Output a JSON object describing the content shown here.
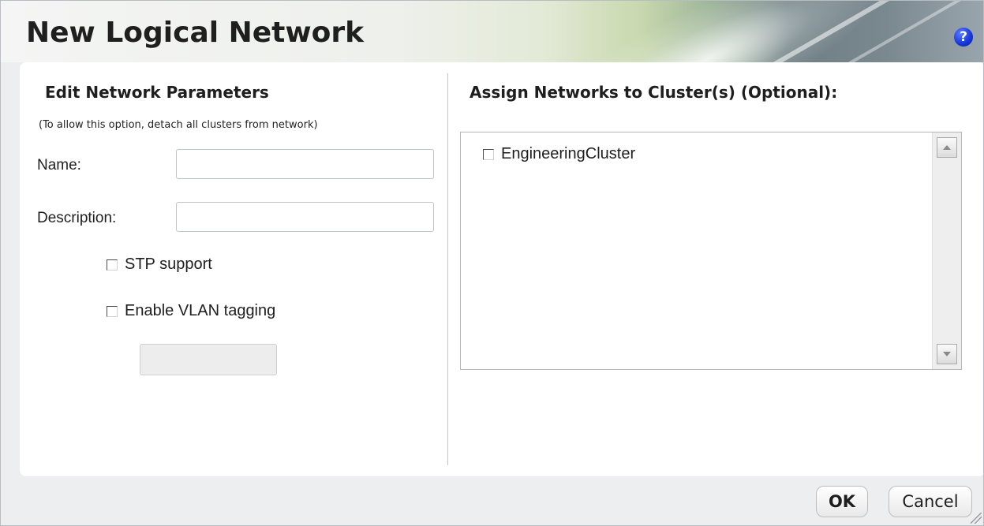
{
  "dialog": {
    "title": "New Logical Network",
    "help_icon": "question-icon",
    "help_glyph": "?"
  },
  "left": {
    "section_title": "Edit Network Parameters",
    "hint": "(To allow this option, detach all clusters from network)",
    "name_label": "Name:",
    "name_value": "",
    "description_label": "Description:",
    "description_value": "",
    "stp_label": "STP support",
    "stp_checked": false,
    "vlan_label": "Enable VLAN tagging",
    "vlan_checked": false,
    "vlan_id_value": ""
  },
  "right": {
    "section_title": "Assign Networks to Cluster(s) (Optional):",
    "clusters": [
      {
        "label": "EngineeringCluster",
        "checked": false
      }
    ]
  },
  "footer": {
    "ok_label": "OK",
    "cancel_label": "Cancel"
  },
  "colors": {
    "help_icon": "#1536d9",
    "content_bg": "#ffffff",
    "dialog_bg": "#eceef0"
  }
}
